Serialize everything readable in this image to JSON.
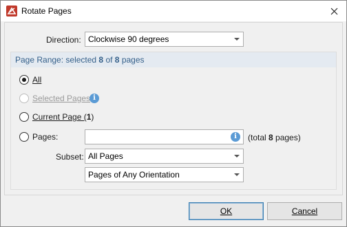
{
  "window": {
    "title": "Rotate Pages"
  },
  "direction": {
    "label": "Direction:",
    "value": "Clockwise 90 degrees"
  },
  "page_range": {
    "title_prefix": "Page Range: selected ",
    "selected": "8",
    "of": " of ",
    "total": "8",
    "suffix": " pages"
  },
  "options": {
    "all": "All",
    "selected_pages": "Selected Pages",
    "current_page_prefix": "Current Page (",
    "current_page_num": "1",
    "current_page_suffix": ")",
    "pages": "Pages:",
    "pages_value": "",
    "total_prefix": "(total ",
    "total_num": "8",
    "total_suffix": " pages)"
  },
  "subset": {
    "label": "Subset:",
    "value": "All Pages",
    "orientation_value": "Pages of Any Orientation"
  },
  "buttons": {
    "ok": "OK",
    "cancel": "Cancel"
  },
  "colors": {
    "accent": "#35608a",
    "header_bg": "#e4eaf1",
    "info_icon": "#5b9bd5",
    "app_icon": "#c0392b"
  },
  "selection": {
    "checked_option": "All"
  }
}
